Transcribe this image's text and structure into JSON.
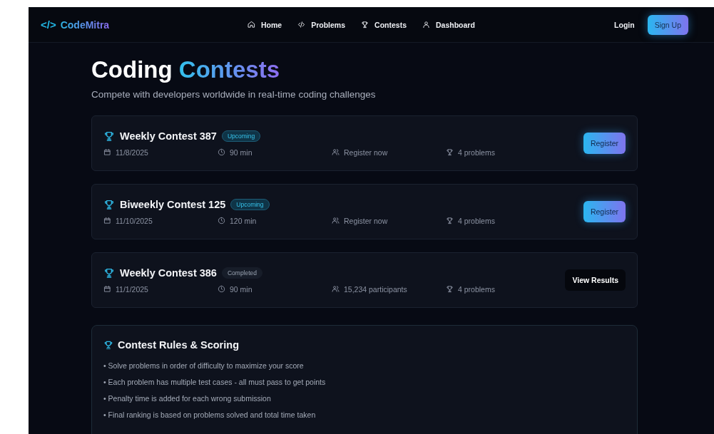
{
  "brand": {
    "icon_text": "</>",
    "name": "CodeMitra"
  },
  "nav": [
    {
      "label": "Home"
    },
    {
      "label": "Problems"
    },
    {
      "label": "Contests"
    },
    {
      "label": "Dashboard"
    }
  ],
  "auth": {
    "login": "Login",
    "signup": "Sign Up"
  },
  "heading": {
    "plain": "Coding",
    "accent": "Contests"
  },
  "subtitle": "Compete with developers worldwide in real-time coding challenges",
  "contests": [
    {
      "title": "Weekly Contest 387",
      "status": "Upcoming",
      "kind": "upcoming",
      "date": "11/8/2025",
      "duration": "90 min",
      "people": "Register now",
      "problems": "4 problems",
      "action": "Register"
    },
    {
      "title": "Biweekly Contest 125",
      "status": "Upcoming",
      "kind": "upcoming",
      "date": "11/10/2025",
      "duration": "120 min",
      "people": "Register now",
      "problems": "4 problems",
      "action": "Register"
    },
    {
      "title": "Weekly Contest 386",
      "status": "Completed",
      "kind": "completed",
      "date": "11/1/2025",
      "duration": "90 min",
      "people": "15,234 participants",
      "problems": "4 problems",
      "action": "View Results"
    }
  ],
  "rules": {
    "title": "Contest Rules & Scoring",
    "items": [
      "• Solve problems in order of difficulty to maximize your score",
      "• Each problem has multiple test cases - all must pass to get points",
      "• Penalty time is added for each wrong submission",
      "• Final ranking is based on problems solved and total time taken"
    ]
  }
}
